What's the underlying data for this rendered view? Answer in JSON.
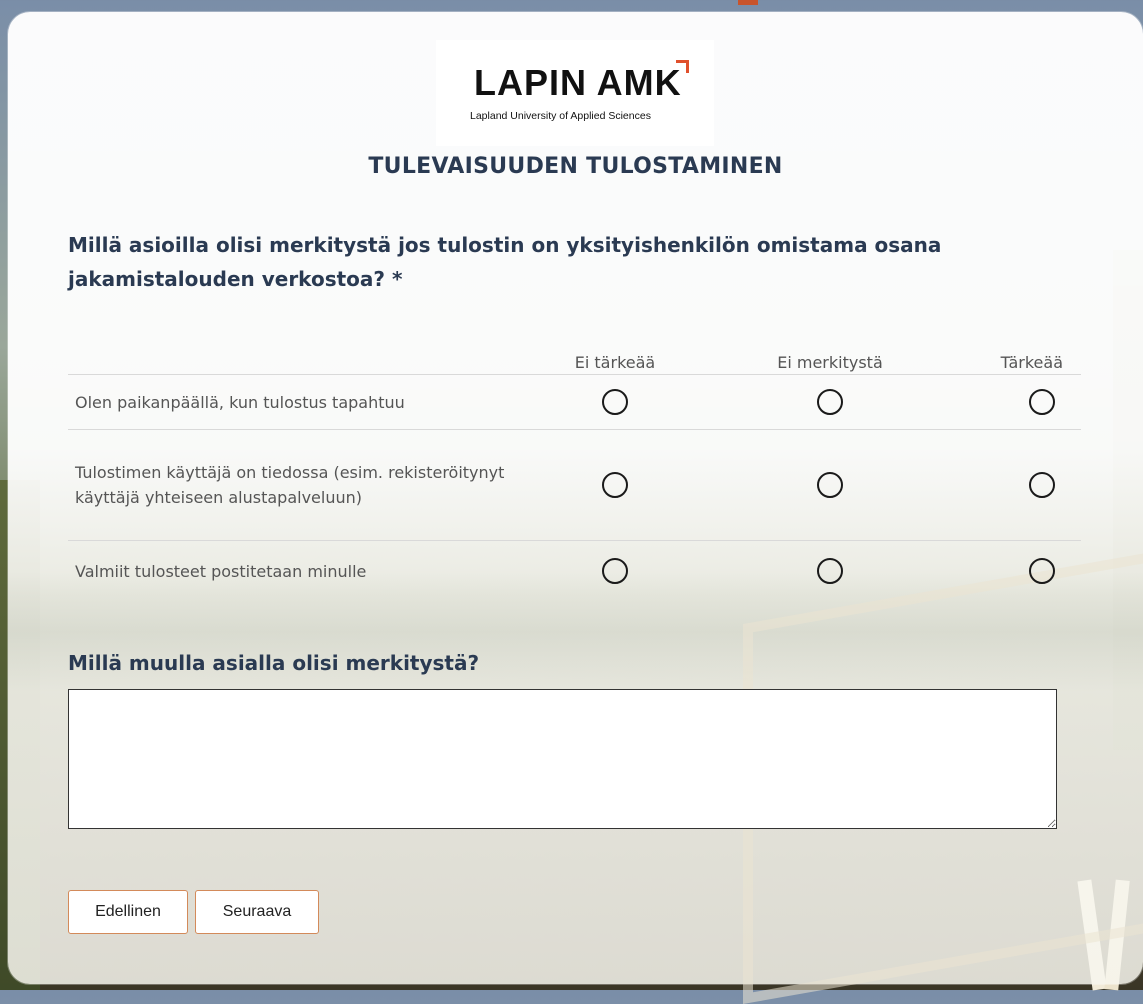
{
  "logo": {
    "name": "LAPIN AMK",
    "subtitle": "Lapland University of Applied Sciences"
  },
  "page_title": "TULEVAISUUDEN TULOSTAMINEN",
  "question1": {
    "text": "Millä asioilla olisi merkitystä jos tulostin on yksityishenkilön omistama osana jakamistalouden verkostoa? *"
  },
  "matrix": {
    "columns": [
      "Ei tärkeää",
      "Ei merkitystä",
      "Tärkeää"
    ],
    "rows": [
      {
        "label": "Olen paikanpäällä, kun tulostus tapahtuu",
        "selected": null
      },
      {
        "label": "Tulostimen käyttäjä on tiedossa (esim. rekisteröitynyt käyttäjä yhteiseen alustapalveluun)",
        "selected": null
      },
      {
        "label": "Valmiit tulosteet postitetaan minulle",
        "selected": null
      }
    ]
  },
  "question2": {
    "text": "Millä muulla asialla olisi merkitystä?",
    "value": ""
  },
  "buttons": {
    "previous": "Edellinen",
    "next": "Seuraava"
  },
  "colors": {
    "heading": "#2a3a52",
    "logo_accent": "#e0502c",
    "button_border": "#d38a5a"
  }
}
